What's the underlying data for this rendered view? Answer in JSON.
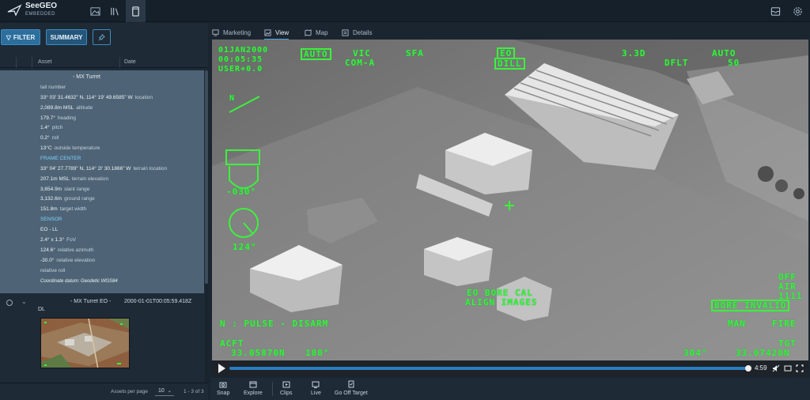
{
  "app": {
    "logo_line1": "SeeGEO",
    "logo_line2": "EMBEDDED",
    "top_icons": [
      "image-icon",
      "library-icon",
      "tablet-icon"
    ],
    "top_right_icons": [
      "inbox-icon",
      "gear-icon"
    ]
  },
  "toolbar": {
    "filter_label": "FILTER",
    "summary_label": "SUMMARY",
    "pin_icon": "pin-icon"
  },
  "table": {
    "col_asset": "Asset",
    "col_date": "Date"
  },
  "details": {
    "title": "- MX Turret",
    "rows": [
      {
        "value": "",
        "key": "tail number"
      },
      {
        "value": "33° 03' 31.4632\" N, 114° 19' 49.6585\" W",
        "key": "location"
      },
      {
        "value": "2,089.8m MSL",
        "key": "altitude"
      },
      {
        "value": "179.7°",
        "key": "heading"
      },
      {
        "value": "1.4°",
        "key": "pitch"
      },
      {
        "value": "0.2°",
        "key": "roll"
      },
      {
        "value": "13°C",
        "key": "outside temperature"
      }
    ],
    "section_frame": "FRAME CENTER",
    "frame_rows": [
      {
        "value": "33° 04' 27.7789\" N, 114° 2l' 30.1866\" W",
        "key": "terrain location"
      },
      {
        "value": "207.1m MSL",
        "key": "terrain elevation"
      },
      {
        "value": "3,654.9m",
        "key": "slant range"
      },
      {
        "value": "3,132.6m",
        "key": "ground range"
      },
      {
        "value": "151.8m",
        "key": "target width"
      }
    ],
    "section_sensor": "SENSOR",
    "sensor_rows": [
      {
        "value": "EO - LL",
        "key": ""
      },
      {
        "value": "2.4° x 1.3°",
        "key": "FoV"
      },
      {
        "value": "124.6°",
        "key": "relative azimuth"
      },
      {
        "value": "-30.0°",
        "key": "relative elevation"
      },
      {
        "value": "",
        "key": "relative roll"
      }
    ],
    "datum": "Coordinate datum: Geodetic WGS84"
  },
  "row2": {
    "asset": "- MX Turret EO -",
    "asset_suffix": "DL",
    "date": "2000-01-01T00:05:59.418Z"
  },
  "pager": {
    "assets_per_page_label": "Assets per page",
    "page_size": "10",
    "range": "1 - 3 of 3"
  },
  "tabs": [
    {
      "label": "Marketing",
      "icon": "monitor-icon"
    },
    {
      "label": "View",
      "icon": "image-icon",
      "active": true
    },
    {
      "label": "Map",
      "icon": "map-icon"
    },
    {
      "label": "Details",
      "icon": "list-icon"
    }
  ],
  "hud": {
    "date": "01JAN2000",
    "time": "00:05:35",
    "user": "USER+0.0",
    "auto_box": "AUTO",
    "vic": "VIC",
    "com": "COM-A",
    "sfa": "SFA",
    "eo": "EO",
    "dill": "DILL",
    "zoom": "3.3D",
    "dflt": "DFLT",
    "auto_right": "AUTO",
    "fifty": "50",
    "az": "-030°",
    "el": "124°",
    "bore_cal": "EO BORE CAL",
    "align": "ALIGN IMAGES",
    "off": "OFF",
    "air": "AIR",
    "code": "1111",
    "bore_invalid": "BORE INVALID",
    "pulse": "N : PULSE - DISARM",
    "man": "MAN",
    "fire": "FIRE",
    "acft": "ACFT",
    "tgt": "TGT",
    "lat_left": "33.05870N",
    "hdg_left": "180°",
    "lat_right": "33.07420N",
    "hdg_right": "304°"
  },
  "player": {
    "time": "4:59",
    "progress": 0.99
  },
  "actions": [
    {
      "label": "Snap",
      "icon": "camera-icon"
    },
    {
      "label": "Explore",
      "icon": "explore-icon"
    },
    {
      "label": "Clips",
      "icon": "clips-icon"
    },
    {
      "label": "Live",
      "icon": "live-icon"
    },
    {
      "label": "Go Off Target",
      "icon": "target-icon"
    }
  ]
}
